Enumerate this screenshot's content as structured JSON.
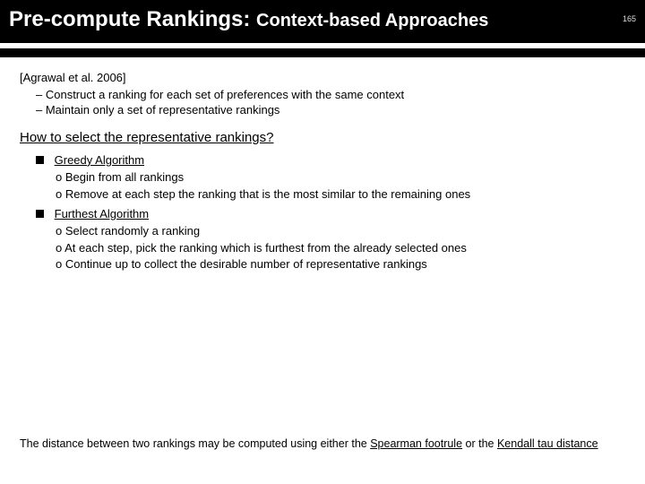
{
  "title": {
    "main": "Pre-compute Rankings: ",
    "sub": "Context-based Approaches",
    "page": "165"
  },
  "citation": "[Agrawal et al. 2006]",
  "intro": [
    "Construct a ranking for each set of preferences with the same context",
    "Maintain only a set of representative rankings"
  ],
  "question": "How to select the representative rankings?",
  "algos": [
    {
      "name": "Greedy Algorithm",
      "steps": [
        "Begin from all rankings",
        "Remove at each step the ranking that is the most similar to the remaining ones"
      ]
    },
    {
      "name": "Furthest Algorithm",
      "steps": [
        "Select randomly a ranking",
        "At each step, pick the ranking which is furthest from the already selected ones",
        "Continue up to collect the desirable number of representative rankings"
      ]
    }
  ],
  "foot": {
    "pre": "The distance between two rankings may be computed using either the ",
    "m1": "Spearman footrule",
    "mid": " or the ",
    "m2": "Kendall tau distance"
  }
}
